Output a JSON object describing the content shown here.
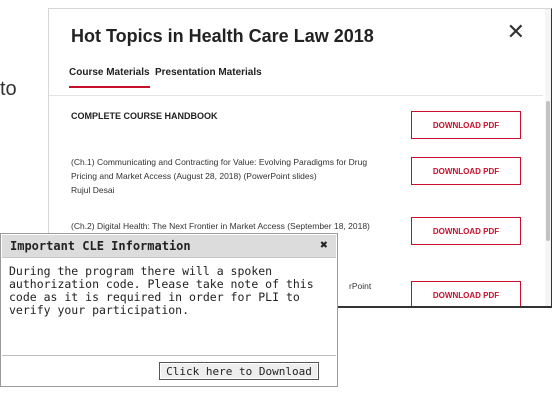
{
  "background": {
    "partial_text": "to"
  },
  "modal": {
    "title": "Hot Topics in Health Care Law 2018",
    "close_glyph": "✕",
    "tabs": [
      {
        "label": "Course Materials",
        "active": true
      },
      {
        "label": "Presentation Materials",
        "active": false
      }
    ],
    "section_heading": "COMPLETE COURSE HANDBOOK",
    "rows": [
      {
        "lines": [
          "(Ch.1) Communicating and Contracting for Value: Evolving Paradigms for Drug",
          "Pricing and Market Access (August 28, 2018) (PowerPoint slides)",
          "Rujul Desai"
        ]
      },
      {
        "lines": [
          "(Ch.2) Digital Health: The Next Frontier in Market Access (September 18, 2018)"
        ]
      },
      {
        "lines": [
          "rPoint"
        ]
      }
    ],
    "download_label": "DOWNLOAD PDF",
    "accent_color": "#c8102e"
  },
  "cle_popup": {
    "title": "Important CLE Information",
    "close_glyph": "✖",
    "body": "During the program there will a spoken authorization code. Please take note of this code as it is required in order for PLI to verify your participation.",
    "button_label": "Click here to Download"
  }
}
